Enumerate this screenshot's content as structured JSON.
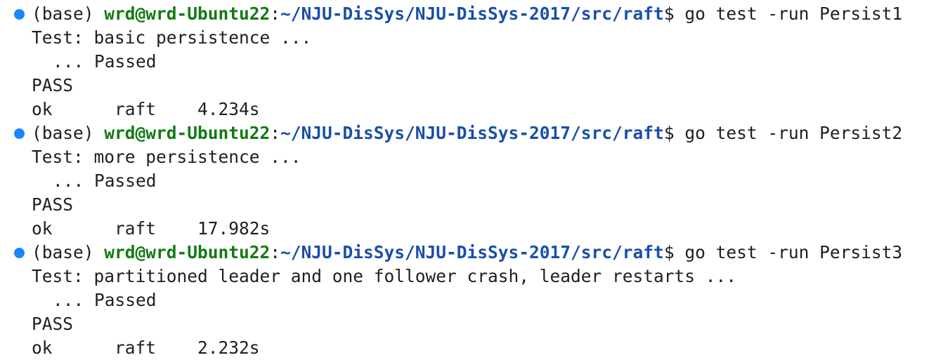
{
  "colors": {
    "prompt_dot": "#1a85ff",
    "user_host": "#137a13",
    "path": "#1a4fa8",
    "text": "#1f1f1f"
  },
  "terminal": {
    "blocks": [
      {
        "env": "(base) ",
        "user_host": "wrd@wrd-Ubuntu22",
        "colon": ":",
        "path": "~/NJU-DisSys/NJU-DisSys-2017/src/raft",
        "prompt_symbol": "$ ",
        "command": "go test -run Persist1",
        "test_line": "Test: basic persistence ...",
        "passed_line": "... Passed",
        "pass_line": "PASS",
        "result_line": "ok      raft    4.234s"
      },
      {
        "env": "(base) ",
        "user_host": "wrd@wrd-Ubuntu22",
        "colon": ":",
        "path": "~/NJU-DisSys/NJU-DisSys-2017/src/raft",
        "prompt_symbol": "$ ",
        "command": "go test -run Persist2",
        "test_line": "Test: more persistence ...",
        "passed_line": "... Passed",
        "pass_line": "PASS",
        "result_line": "ok      raft    17.982s"
      },
      {
        "env": "(base) ",
        "user_host": "wrd@wrd-Ubuntu22",
        "colon": ":",
        "path": "~/NJU-DisSys/NJU-DisSys-2017/src/raft",
        "prompt_symbol": "$ ",
        "command": "go test -run Persist3",
        "test_line": "Test: partitioned leader and one follower crash, leader restarts ...",
        "passed_line": "... Passed",
        "pass_line": "PASS",
        "result_line": "ok      raft    2.232s"
      }
    ]
  }
}
